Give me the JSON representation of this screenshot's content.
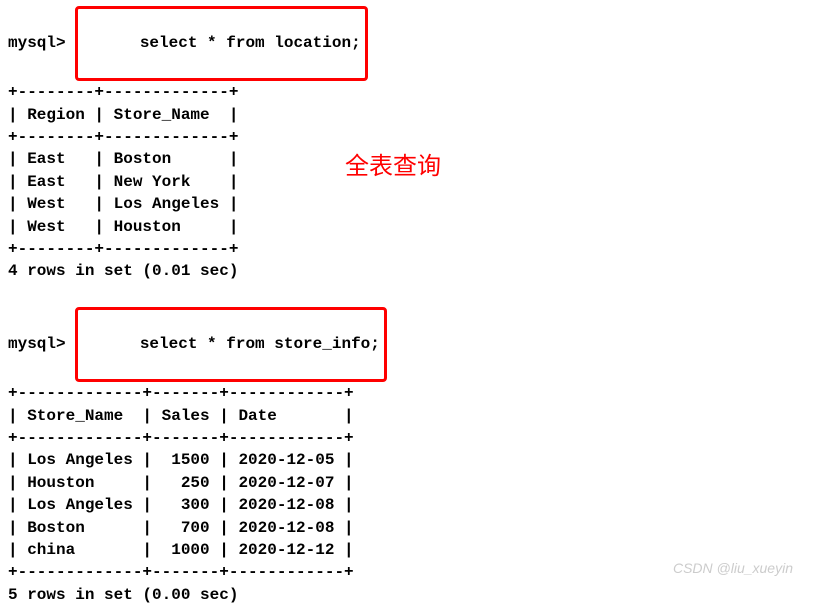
{
  "query1": {
    "prompt": "mysql>",
    "sql": "select * from location;",
    "table_text": "+--------+-------------+\n| Region | Store_Name  |\n+--------+-------------+\n| East   | Boston      |\n| East   | New York    |\n| West   | Los Angeles |\n| West   | Houston     |\n+--------+-------------+",
    "result_msg": "4 rows in set (0.01 sec)",
    "annotation": "全表查询"
  },
  "query2": {
    "prompt": "mysql>",
    "sql": "select * from store_info;",
    "table_text": "+-------------+-------+------------+\n| Store_Name  | Sales | Date       |\n+-------------+-------+------------+\n| Los Angeles |  1500 | 2020-12-05 |\n| Houston     |   250 | 2020-12-07 |\n| Los Angeles |   300 | 2020-12-08 |\n| Boston      |   700 | 2020-12-08 |\n| china       |  1000 | 2020-12-12 |\n+-------------+-------+------------+",
    "result_msg": "5 rows in set (0.00 sec)"
  },
  "chart_data": {
    "type": "table",
    "tables": [
      {
        "name": "location",
        "columns": [
          "Region",
          "Store_Name"
        ],
        "rows": [
          [
            "East",
            "Boston"
          ],
          [
            "East",
            "New York"
          ],
          [
            "West",
            "Los Angeles"
          ],
          [
            "West",
            "Houston"
          ]
        ]
      },
      {
        "name": "store_info",
        "columns": [
          "Store_Name",
          "Sales",
          "Date"
        ],
        "rows": [
          [
            "Los Angeles",
            1500,
            "2020-12-05"
          ],
          [
            "Houston",
            250,
            "2020-12-07"
          ],
          [
            "Los Angeles",
            300,
            "2020-12-08"
          ],
          [
            "Boston",
            700,
            "2020-12-08"
          ],
          [
            "china",
            1000,
            "2020-12-12"
          ]
        ]
      }
    ]
  },
  "watermark": "CSDN @liu_xueyin"
}
